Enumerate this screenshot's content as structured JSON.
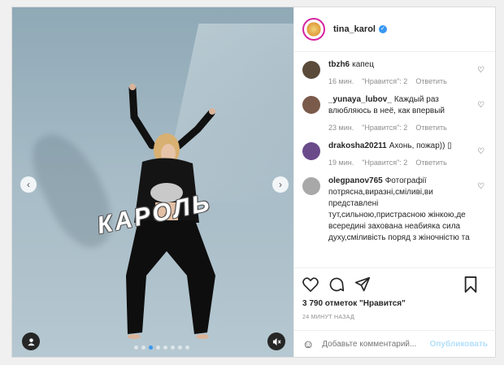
{
  "post": {
    "username": "tina_karol",
    "verified": true,
    "media_text": "КАРОЛЬ",
    "media_dots": 8,
    "media_active_dot": 2
  },
  "comments": [
    {
      "user": "tbzh6",
      "text": "капец⁣⁣⁣",
      "time": "16 мин.",
      "likes": "\"Нравится\": 2",
      "reply": "Ответить",
      "avatar_color": "#5a4a3a"
    },
    {
      "user": "_yunaya_lubov_",
      "text": "Каждый раз влюбляюсь в неё, как впервый",
      "time": "23 мин.",
      "likes": "\"Нравится\": 2",
      "reply": "Ответить",
      "avatar_color": "#7a5a4a"
    },
    {
      "user": "drakosha20211",
      "text": "Ахонь, пожар)) ▯",
      "time": "19 мин.",
      "likes": "\"Нравится\": 2",
      "reply": "Ответить",
      "avatar_color": "#6b4a8a"
    },
    {
      "user": "olegpanov765",
      "text": "Фотографії потрясна,виразні,сміливі,ви представлені тут,сильною,пристрасною жінкою,де всередині захована неабияка сила духу,сміливість поряд з жіночністю та",
      "time": "",
      "likes": "",
      "reply": "",
      "avatar_color": "#a8a8a8"
    }
  ],
  "actions": {
    "likes_text": "3 790 отметок \"Нравится\"",
    "time_ago": "24 МИНУТ НАЗАД"
  },
  "comment_box": {
    "placeholder": "Добавьте комментарий...",
    "publish_label": "Опубликовать"
  },
  "colors": {
    "accent": "#3897f0",
    "publish_disabled": "#b2dffc"
  }
}
